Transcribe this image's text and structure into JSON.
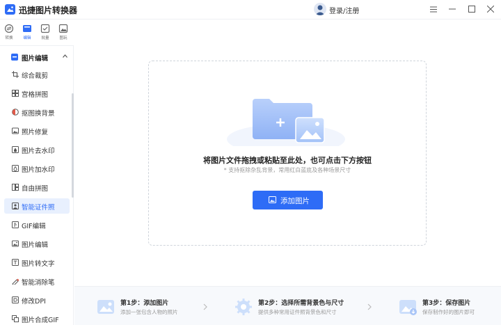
{
  "app": {
    "title": "迅捷图片转换器",
    "login": "登录/注册"
  },
  "rail": [
    {
      "label": "转换",
      "icon": "convert-icon"
    },
    {
      "label": "编辑",
      "icon": "edit-icon"
    },
    {
      "label": "批量",
      "icon": "batch-icon"
    },
    {
      "label": "图玩",
      "icon": "play-icon"
    }
  ],
  "sidebar": {
    "section": "图片编辑",
    "items": [
      {
        "label": "综合裁剪",
        "icon": "crop-icon"
      },
      {
        "label": "宫格拼图",
        "icon": "grid-icon"
      },
      {
        "label": "抠图换背景",
        "icon": "cutout-icon"
      },
      {
        "label": "照片修复",
        "icon": "photo-repair-icon"
      },
      {
        "label": "图片去水印",
        "icon": "remove-watermark-icon"
      },
      {
        "label": "图片加水印",
        "icon": "add-watermark-icon"
      },
      {
        "label": "自由拼图",
        "icon": "free-collage-icon"
      },
      {
        "label": "智能证件照",
        "icon": "id-photo-icon"
      },
      {
        "label": "GIF编辑",
        "icon": "gif-icon"
      },
      {
        "label": "图片编辑",
        "icon": "image-edit-icon"
      },
      {
        "label": "图片转文字",
        "icon": "ocr-icon"
      },
      {
        "label": "智能消除笔",
        "icon": "eraser-icon"
      },
      {
        "label": "修改DPI",
        "icon": "dpi-icon"
      },
      {
        "label": "图片合成GIF",
        "icon": "gif-compose-icon"
      }
    ]
  },
  "main": {
    "drop_text": "将图片文件拖拽或粘贴至此处，也可点击下方按钮",
    "drop_subtext": "* 支持抠除杂乱背景，常用红白蓝底及各种场景尺寸",
    "add_button": "添加图片"
  },
  "steps": [
    {
      "title": "第1步：添加图片",
      "desc": "添加一张包含人物的照片"
    },
    {
      "title": "第2步：选择所需背景色与尺寸",
      "desc": "提供多种常用证件照背景色和尺寸"
    },
    {
      "title": "第3步：保存图片",
      "desc": "保存制作好的图片即可"
    }
  ],
  "colors": {
    "accent": "#2e6cf6",
    "selected_bg": "#e8f0fe"
  }
}
